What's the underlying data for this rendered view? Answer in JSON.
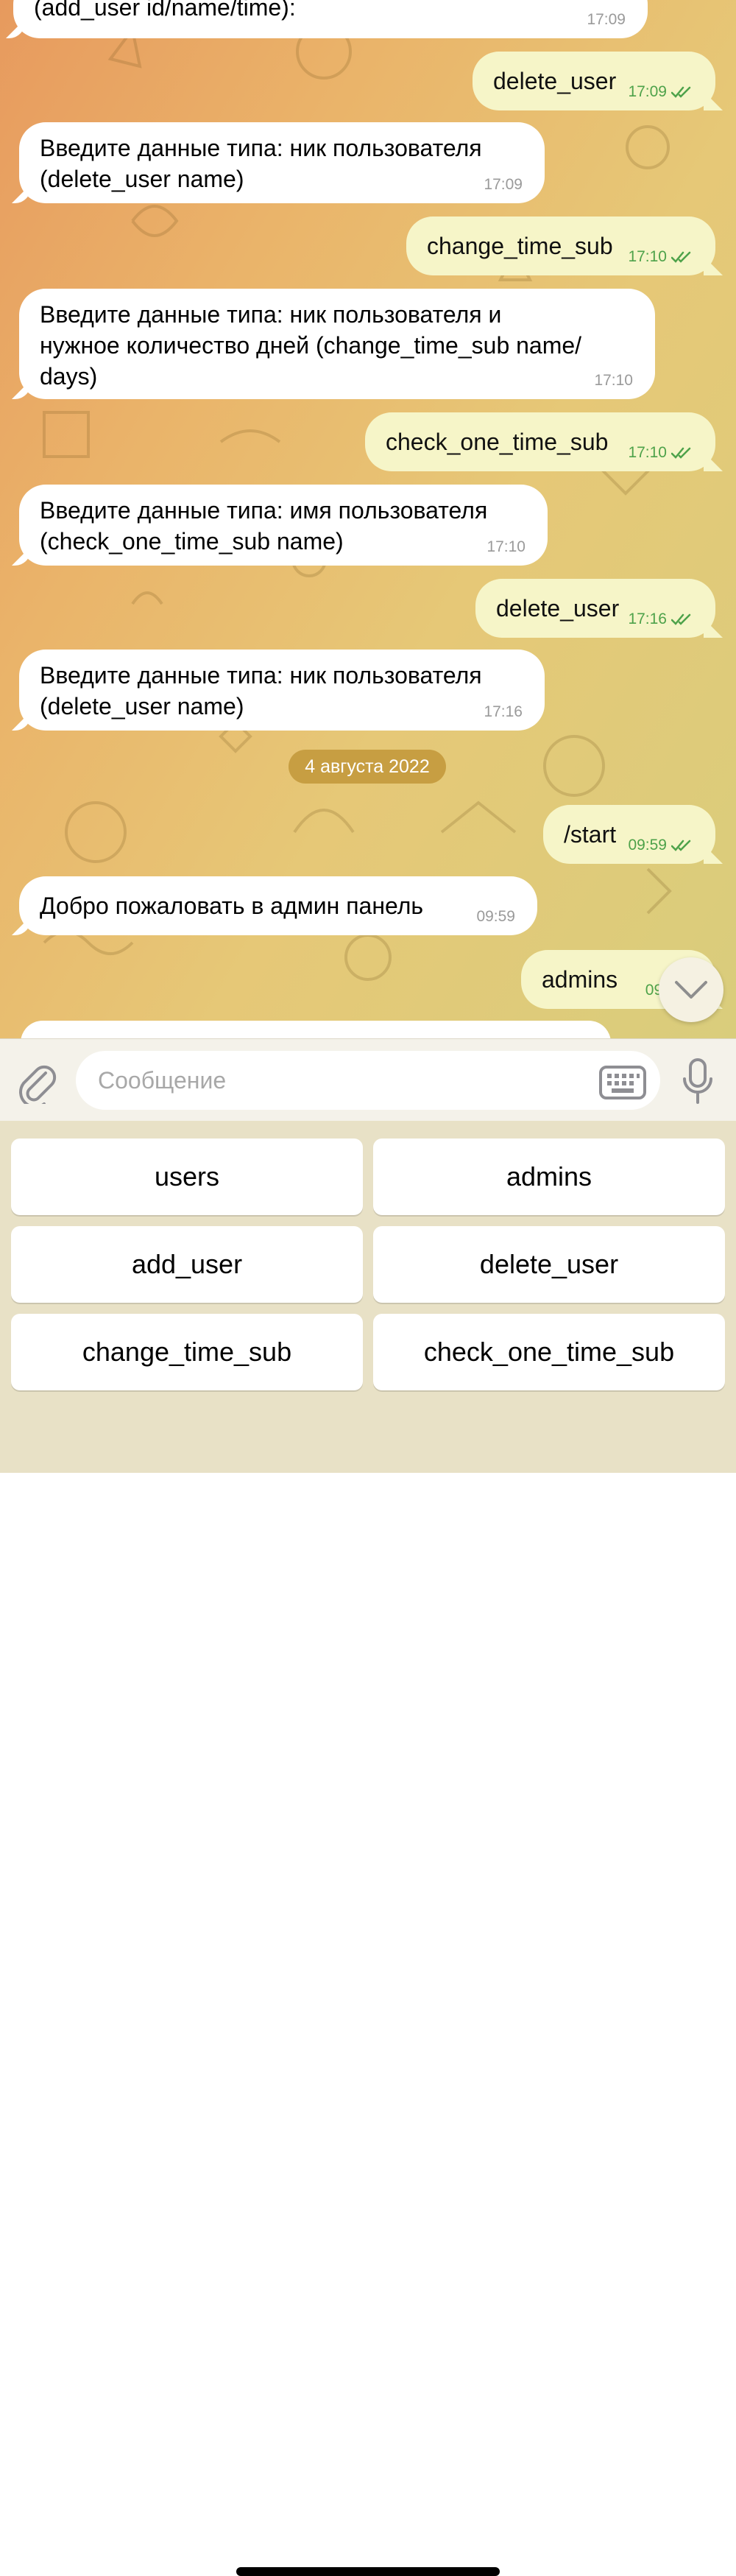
{
  "messages": [
    {
      "dir": "in",
      "text": "(add_user id/name/time):",
      "time": "17:09"
    },
    {
      "dir": "out",
      "text": "delete_user",
      "time": "17:09"
    },
    {
      "dir": "in",
      "text": "Введите данные типа: ник пользователя\n(delete_user name)",
      "time": "17:09"
    },
    {
      "dir": "out",
      "text": "change_time_sub",
      "time": "17:10"
    },
    {
      "dir": "in",
      "text": "Введите данные типа: ник пользователя и\nнужное количество дней (change_time_sub name/\ndays)",
      "time": "17:10"
    },
    {
      "dir": "out",
      "text": "check_one_time_sub",
      "time": "17:10"
    },
    {
      "dir": "in",
      "text": "Введите данные типа: имя пользователя\n(check_one_time_sub name)",
      "time": "17:10"
    },
    {
      "dir": "out",
      "text": "delete_user",
      "time": "17:16"
    },
    {
      "dir": "in",
      "text": "Введите данные типа: ник пользователя\n(delete_user name)",
      "time": "17:16"
    },
    {
      "dir": "out",
      "text": "/start",
      "time": "09:59"
    },
    {
      "dir": "in",
      "text": "Добро пожаловать в админ панель",
      "time": "09:59"
    },
    {
      "dir": "out",
      "text": "admins",
      "time": "09:"
    }
  ],
  "date_separator": "4 августа 2022",
  "input": {
    "placeholder": "Сообщение"
  },
  "keyboard": [
    "users",
    "admins",
    "add_user",
    "delete_user",
    "change_time_sub",
    "check_one_time_sub"
  ],
  "colors": {
    "out_bubble": "#f6f5c8",
    "in_bubble": "#ffffff",
    "time_out": "#4ea24a",
    "date_pill": "#c79e42"
  },
  "icons": [
    "paperclip-icon",
    "keyboard-icon",
    "microphone-icon",
    "chevron-down-icon",
    "double-check-icon"
  ]
}
